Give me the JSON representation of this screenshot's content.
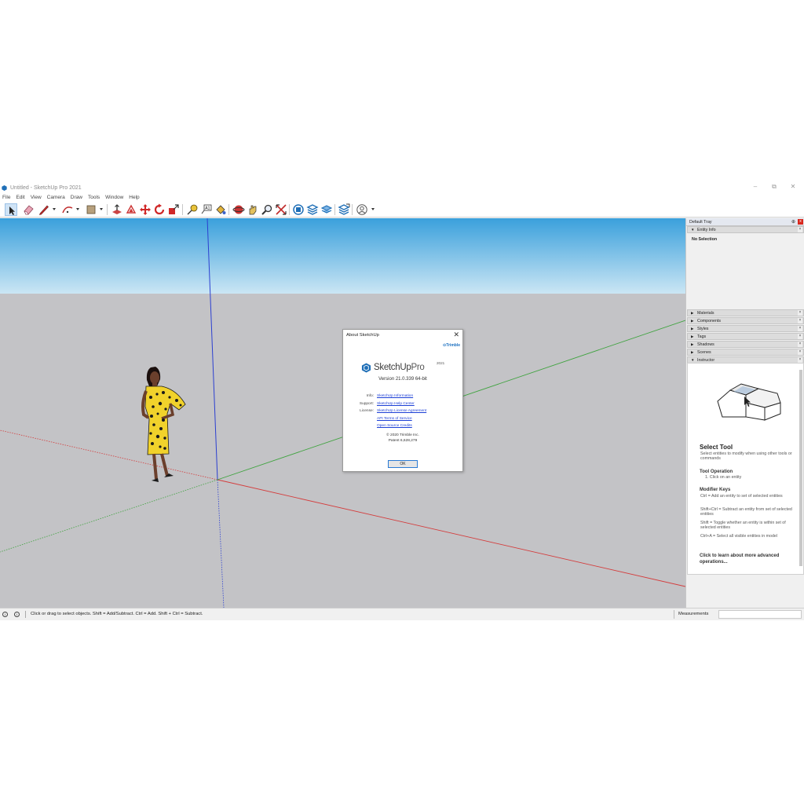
{
  "window": {
    "title": "Untitled - SketchUp Pro 2021",
    "controls": {
      "minimize": "–",
      "maximize": "⧉",
      "close": "✕"
    }
  },
  "menu": [
    "File",
    "Edit",
    "View",
    "Camera",
    "Draw",
    "Tools",
    "Window",
    "Help"
  ],
  "toolbar": {
    "tools": [
      "select-icon",
      "eraser-icon",
      "pencil-line-icon",
      "arc-icon",
      "rectangle-icon",
      "push-pull-icon",
      "offset-icon",
      "move-icon",
      "rotate-icon",
      "scale-icon",
      "tape-measure-icon",
      "text-icon",
      "paint-bucket-icon",
      "orbit-icon",
      "pan-icon",
      "zoom-icon",
      "zoom-extents-icon",
      "warehouse-icon",
      "extension-warehouse-icon",
      "layout-icon",
      "send-icon",
      "account-icon"
    ],
    "active_tool": "select-icon"
  },
  "about_dialog": {
    "title": "About SketchUp",
    "close": "✕",
    "trimble": "⊙Trimble",
    "brand_name": "SketchUp",
    "brand_edition": "Pro",
    "brand_year": "2021",
    "version": "Version 21.0.339 64-bit",
    "info_label": "Info:",
    "info_link": "SketchUp Information",
    "support_label": "Support:",
    "support_link": "SketchUp Help Center",
    "license_label": "License:",
    "license_link": "SketchUp License Agreement",
    "api_link": "API Terms of Service",
    "oss_link": "Open Source Credits",
    "copyright": "© 2020 Trimble Inc.",
    "patent": "Patent 6,628,279",
    "ok": "OK"
  },
  "tray": {
    "title": "Default Tray",
    "pin": "⊕",
    "close": "x",
    "entity_info": {
      "label": "Entity Info",
      "status": "No Selection"
    },
    "panels": [
      "Materials",
      "Components",
      "Styles",
      "Tags",
      "Shadows",
      "Scenes"
    ],
    "instructor": {
      "label": "Instructor",
      "heading": "Select Tool",
      "desc": "Select entities to modify when using other tools or commands",
      "op_heading": "Tool Operation",
      "op_step": "1. Click on an entity",
      "mod_heading": "Modifier Keys",
      "mod_1": "Ctrl = Add an entity to set of selected entities",
      "mod_2": "Shift+Ctrl = Subtract an entity from set of selected entities",
      "mod_3": "Shift = Toggle whether an entity is within set of selected entities",
      "mod_4": "Ctrl+A = Select all visible entities in model",
      "more": "Click to learn about more advanced operations..."
    }
  },
  "statusbar": {
    "hint": "Click or drag to select objects. Shift = Add/Subtract. Ctrl = Add. Shift + Ctrl = Subtract.",
    "measurements_label": "Measurements",
    "measurements_value": ""
  },
  "colors": {
    "sky_top": "#3aa0dc",
    "sky_bottom": "#cbe6f4",
    "ground": "#c3c3c6",
    "axis_red": "#d43c3c",
    "axis_green": "#3fa33f",
    "axis_blue": "#2b3fd0",
    "link": "#1c3fd6"
  }
}
